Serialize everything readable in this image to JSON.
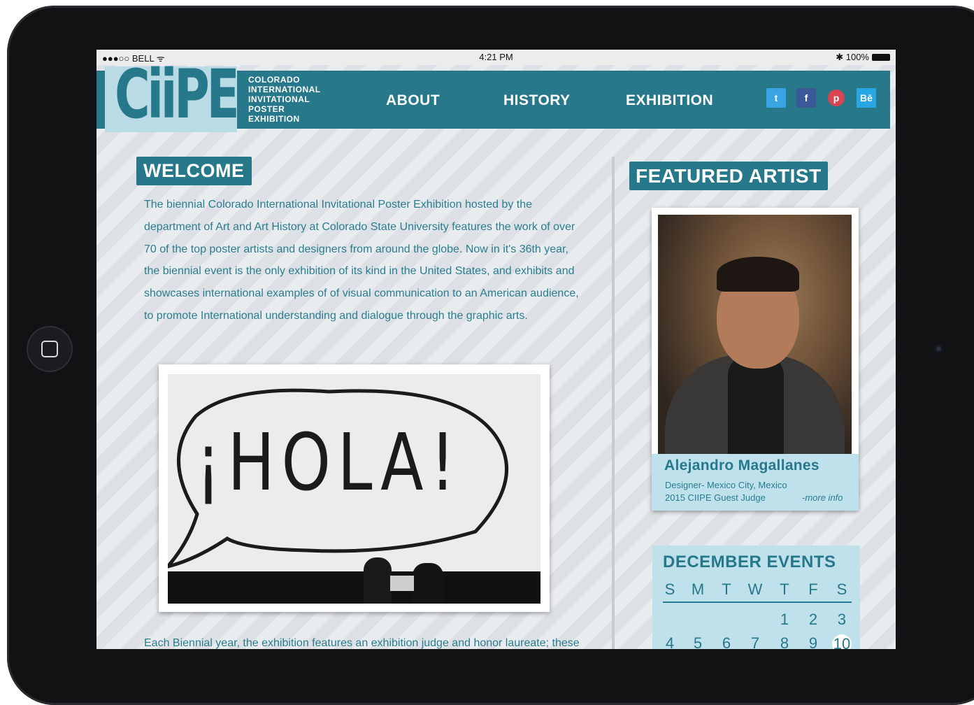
{
  "status_bar": {
    "carrier": "●●●○○ BELL ᯤ",
    "time": "4:21 PM",
    "battery": "✱ 100%"
  },
  "header": {
    "logo": "CiiPE",
    "org_lines": [
      "COLORADO",
      "INTERNATIONAL",
      "INVITATIONAL",
      "POSTER",
      "EXHIBITION"
    ],
    "nav": [
      "ABOUT",
      "HISTORY",
      "EXHIBITION"
    ],
    "social": [
      {
        "name": "twitter",
        "glyph": "t",
        "color": "#3aa3e3"
      },
      {
        "name": "facebook",
        "glyph": "f",
        "color": "#3b5998"
      },
      {
        "name": "pinterest",
        "glyph": "p",
        "color": "#d8444f"
      },
      {
        "name": "behance",
        "glyph": "Bē",
        "color": "#27a6e6"
      }
    ]
  },
  "welcome": {
    "title": "WELCOME",
    "body": "The biennial Colorado International Invitational Poster Exhibition hosted by the department of Art and Art History at Colorado State University features the work of over 70 of the top poster artists and designers from around the globe. Now in it's 36th year, the biennial event is the only exhibition of its kind in the United States, and exhibits and showcases international examples of of visual communication to an American audience, to promote International understanding and dialogue through the graphic arts.",
    "photo_text": "¡HOLA!",
    "bottom_text": "Each Biennial year, the exhibition features an exhibition judge and honor laureate; these"
  },
  "featured": {
    "title": "FEATURED ARTIST",
    "name": "Alejandro Magallanes",
    "role": "Designer- Mexico City, Mexico",
    "judge": "2015 CIIPE Guest Judge",
    "more": "-more info"
  },
  "calendar": {
    "title": "DECEMBER EVENTS",
    "days": [
      "S",
      "M",
      "T",
      "W",
      "T",
      "F",
      "S"
    ],
    "row1": [
      "",
      "",
      "",
      "",
      "1",
      "2",
      "3"
    ],
    "row2": [
      "4",
      "5",
      "6",
      "7",
      "8",
      "9",
      "10"
    ],
    "today": "10"
  }
}
